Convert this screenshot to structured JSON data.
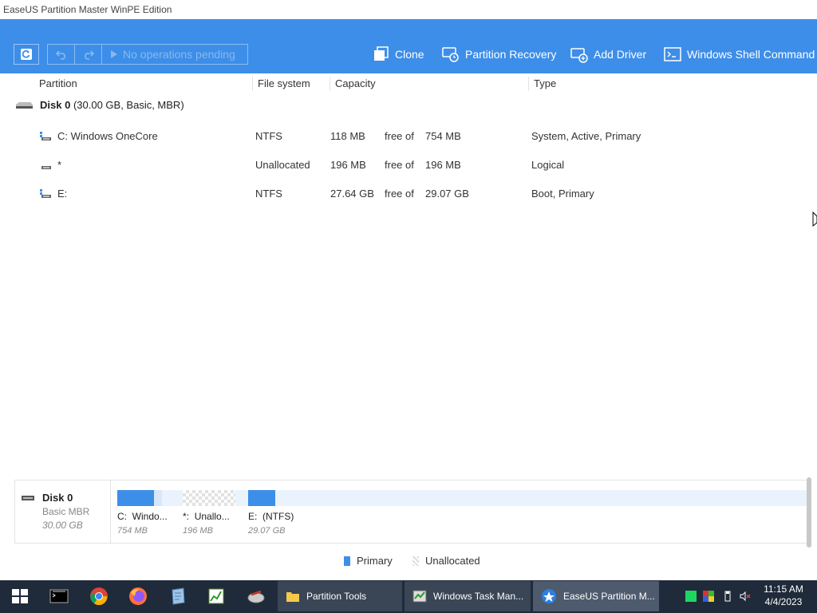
{
  "window": {
    "title": "EaseUS Partition Master WinPE Edition"
  },
  "toolbar": {
    "pending_label": "No operations pending",
    "clone_label": "Clone",
    "partition_recovery_label": "Partition Recovery",
    "add_driver_label": "Add Driver",
    "windows_shell_label": "Windows Shell Command"
  },
  "columns": {
    "partition": "Partition",
    "file_system": "File system",
    "capacity": "Capacity",
    "type": "Type"
  },
  "disk": {
    "name": "Disk 0",
    "details": "(30.00 GB, Basic, MBR)"
  },
  "partitions": [
    {
      "name": "C: Windows OneCore",
      "fs": "NTFS",
      "free": "118 MB",
      "free_of": "free of",
      "total": "754 MB",
      "type": "System, Active, Primary"
    },
    {
      "name": "*",
      "fs": "Unallocated",
      "free": "196 MB",
      "free_of": "free of",
      "total": "196 MB",
      "type": "Logical"
    },
    {
      "name": "E:",
      "fs": "NTFS",
      "free": "27.64 GB",
      "free_of": "free of",
      "total": "29.07 GB",
      "type": "Boot, Primary"
    }
  ],
  "diskmap": {
    "name": "Disk 0",
    "type": "Basic MBR",
    "size": "30.00 GB",
    "segments": [
      {
        "letter": "C:",
        "label": "Windo...",
        "size": "754 MB"
      },
      {
        "letter": "*:",
        "label": "Unallo...",
        "size": "196 MB"
      },
      {
        "letter": "E:",
        "label": "(NTFS)",
        "size": "29.07 GB"
      }
    ]
  },
  "legend": {
    "primary": "Primary",
    "unallocated": "Unallocated"
  },
  "taskbar": {
    "tasks": [
      {
        "label": "Partition Tools"
      },
      {
        "label": "Windows Task Man..."
      },
      {
        "label": "EaseUS Partition M..."
      }
    ],
    "time": "11:15 AM",
    "date": "4/4/2023"
  },
  "colors": {
    "toolbar": "#3d8ee9",
    "primary": "#3d8ee9",
    "taskbar": "#1f2a3a"
  }
}
